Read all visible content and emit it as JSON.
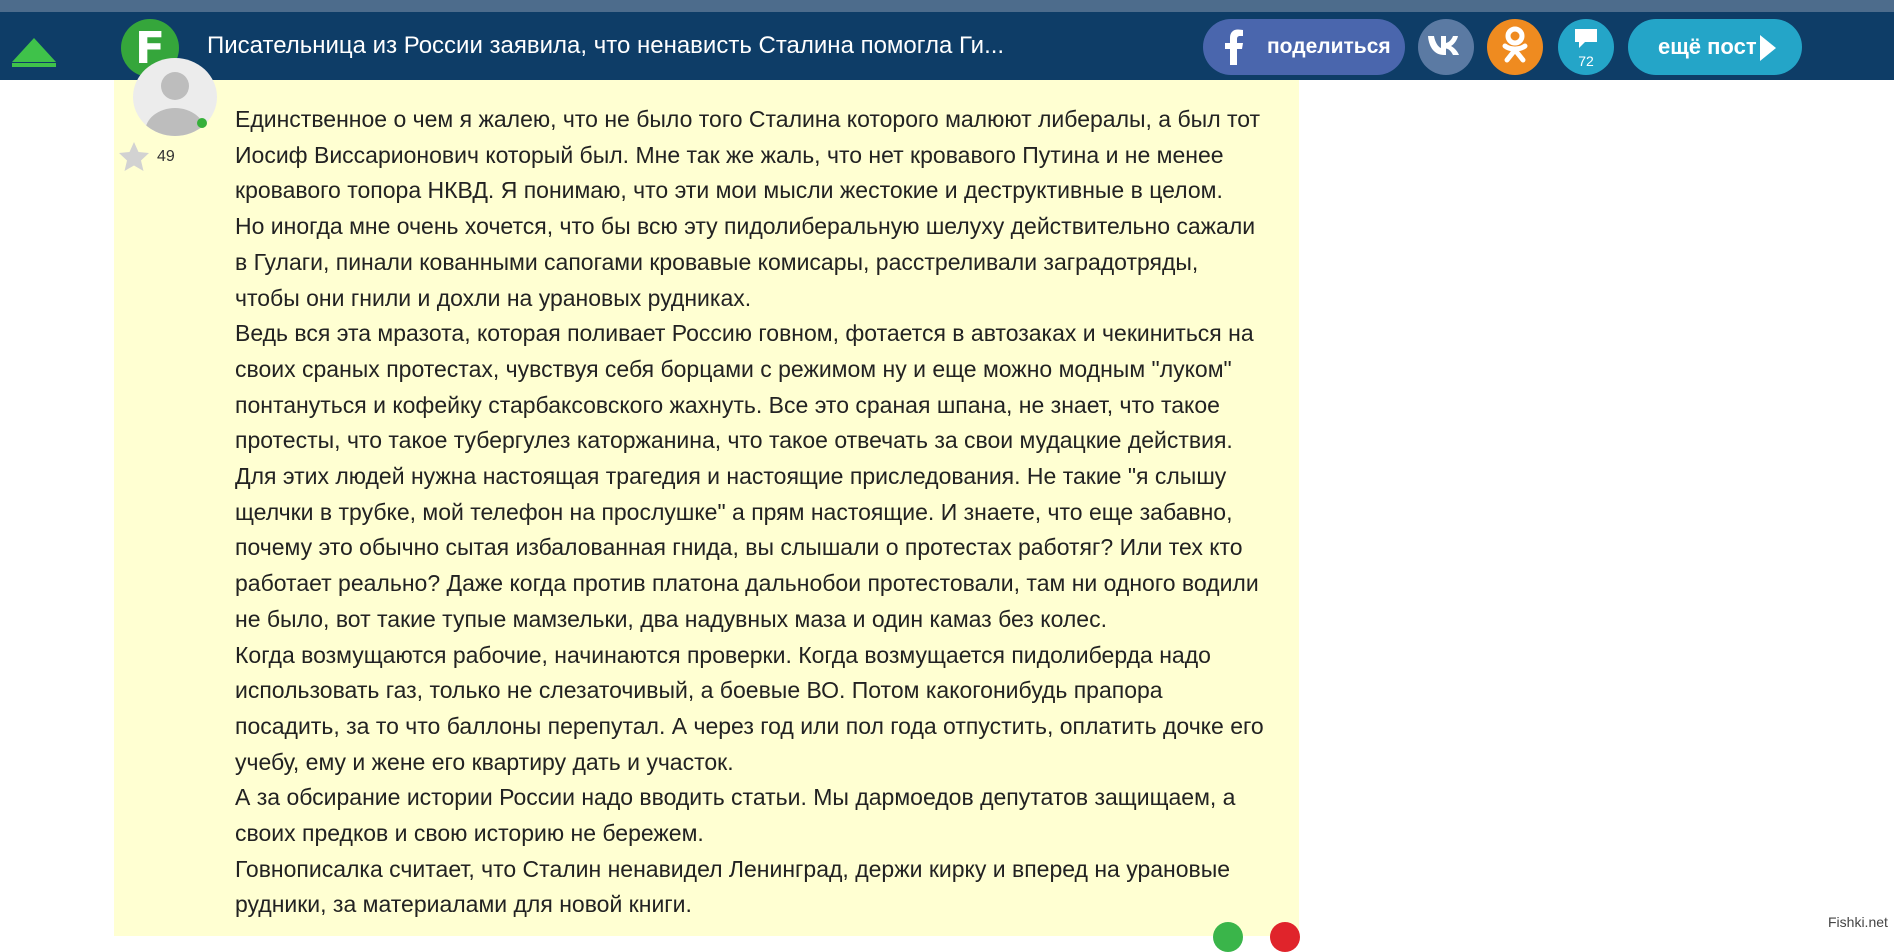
{
  "header": {
    "logo_letter": "F",
    "title": "Писательница из России заявила, что ненависть Сталина помогла Ги...",
    "share_fb_label": "поделиться",
    "comments_count": "72",
    "next_post_label": "ещё пост",
    "icons": {
      "up": "arrow-up-icon",
      "facebook": "facebook-icon",
      "vk": "vk-icon",
      "ok": "odnoklassniki-icon",
      "comments": "comment-bubble-icon",
      "next": "chevron-right-icon"
    },
    "colors": {
      "bar": "#0e3d67",
      "logo": "#35a63b",
      "facebook": "#4a66ad",
      "vk": "#5b7aa3",
      "ok": "#ef8b20",
      "accent": "#24a5c8"
    }
  },
  "comment": {
    "rating": "49",
    "background": "#ffffd2",
    "lines": [
      "Единственное о чем я жалею, что не было того Сталина которого малюют либералы, а был тот",
      "Иосиф Виссарионович который был. Мне так же жаль, что нет кровавого Путина и не менее",
      "кровавого топора НКВД. Я понимаю, что эти мои мысли жестокие и деструктивные в целом.",
      "Но иногда мне очень хочется, что бы всю эту пидолиберальную шелуху действительно сажали",
      "в Гулаги, пинали кованными сапогами кровавые комисары, расстреливали заградотряды,",
      "чтобы они гнили и дохли на урановых рудниках.",
      "Ведь вся эта мразота, которая поливает Россию говном, фотается в автозаках и чекиниться на",
      "своих сраных протестах, чувствуя себя борцами с режимом ну и еще можно модным \"луком\"",
      "понтануться и кофейку старбаксовского жахнуть. Все это сраная шпана, не знает, что такое",
      "протесты, что такое тубергулез каторжанина, что такое отвечать за свои мудацкие действия.",
      "Для этих людей нужна настоящая трагедия и настоящие приследования. Не такие \"я слышу",
      "щелчки в трубке, мой телефон на прослушке\" а прям настоящие. И знаете, что еще забавно,",
      "почему это обычно сытая избалованная гнида, вы слышали о протестах работяг? Или тех кто",
      "работает реально? Даже когда против платона дальнобои протестовали, там ни одного водили",
      "не было, вот такие тупые мамзельки, два надувных маза и один камаз без колес.",
      "Когда возмущаются рабочие, начинаются проверки. Когда возмущается пидолиберда надо",
      "использовать газ, только не слезаточивый, а боевые ВО. Потом какогонибудь прапора",
      "посадить, за то что баллоны перепутал. А через год или пол года отпустить, оплатить дочке его",
      "учебу, ему и жене его квартиру дать и участок.",
      "А за обсирание истории России надо вводить статьи. Мы дармоедов депутатов защищаем, а",
      "своих предков и свою историю не бережем.",
      "Говнописалка считает, что Сталин ненавидел Ленинград, держи кирку и вперед на урановые",
      "рудники, за материалами для новой книги."
    ]
  },
  "watermark": "Fishki.net"
}
